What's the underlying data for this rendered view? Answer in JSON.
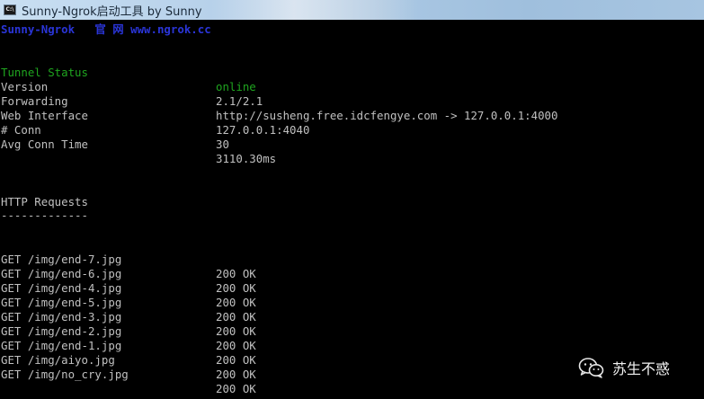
{
  "window": {
    "title": "Sunny-Ngrok启动工具 by Sunny",
    "icon_text": "C:\\"
  },
  "header": {
    "brand": "Sunny-Ngrok   官 网 www.ngrok.cc"
  },
  "status": [
    {
      "label": "Tunnel Status",
      "value": "online"
    },
    {
      "label": "Version",
      "value": "2.1/2.1"
    },
    {
      "label": "Forwarding",
      "value": "http://susheng.free.idcfengye.com -> 127.0.0.1:4000"
    },
    {
      "label": "Web Interface",
      "value": "127.0.0.1:4040"
    },
    {
      "label": "# Conn",
      "value": "30"
    },
    {
      "label": "Avg Conn Time",
      "value": "3110.30ms"
    }
  ],
  "http": {
    "heading": "HTTP Requests",
    "divider": "-------------",
    "requests": [
      {
        "request": "GET /img/end-7.jpg",
        "status": "200 OK"
      },
      {
        "request": "GET /img/end-6.jpg",
        "status": "200 OK"
      },
      {
        "request": "GET /img/end-4.jpg",
        "status": "200 OK"
      },
      {
        "request": "GET /img/end-5.jpg",
        "status": "200 OK"
      },
      {
        "request": "GET /img/end-3.jpg",
        "status": "200 OK"
      },
      {
        "request": "GET /img/end-2.jpg",
        "status": "200 OK"
      },
      {
        "request": "GET /img/end-1.jpg",
        "status": "200 OK"
      },
      {
        "request": "GET /img/aiyo.jpg",
        "status": "200 OK"
      },
      {
        "request": "GET /img/no_cry.jpg",
        "status": "200 OK"
      }
    ]
  },
  "watermark": {
    "text": "苏生不惑",
    "icon": "wechat-icon"
  },
  "colors": {
    "brand": "#2a35d8",
    "status_online": "#1fa51f",
    "console_text": "#c0c0c0",
    "console_bg": "#000000"
  }
}
